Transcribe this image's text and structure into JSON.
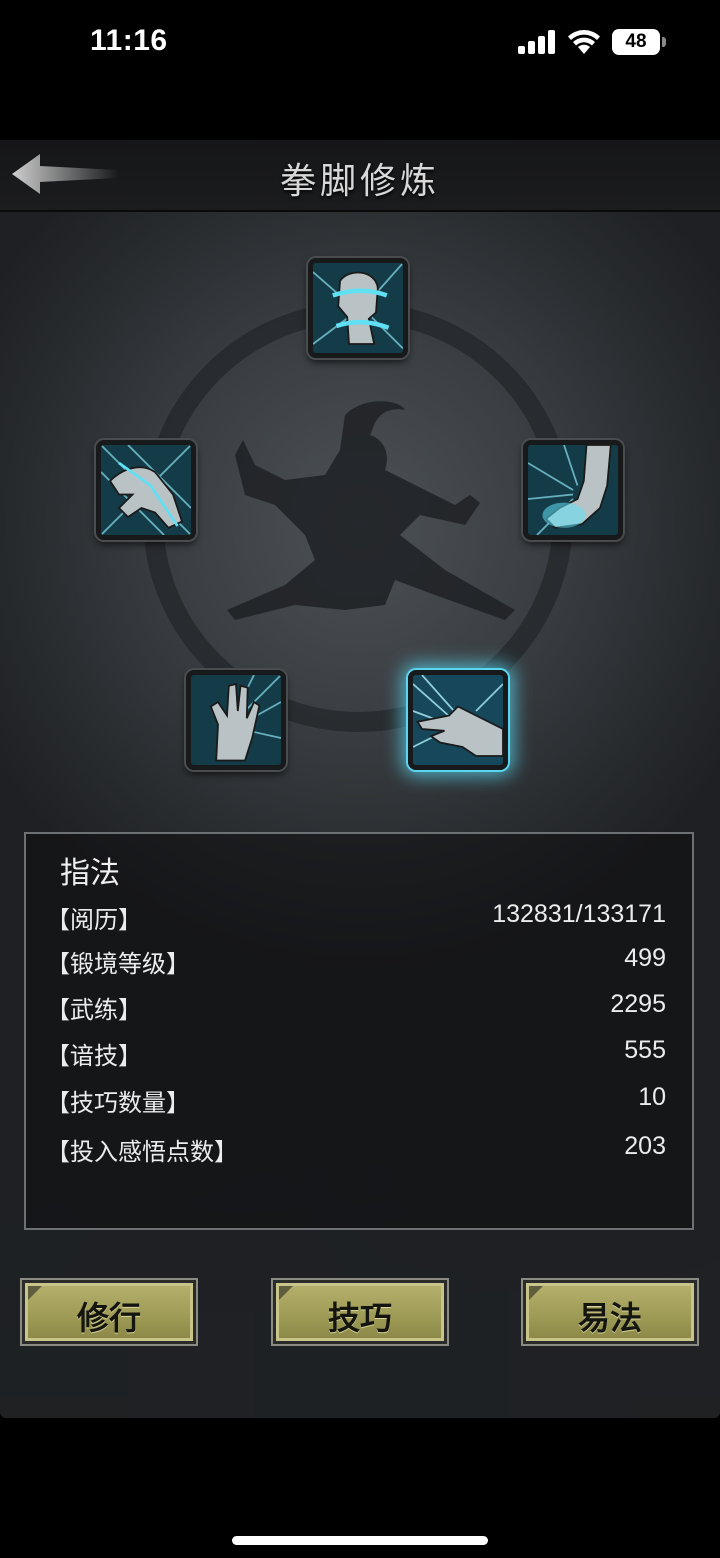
{
  "status_bar": {
    "time": "11:16",
    "battery": "48"
  },
  "header": {
    "title": "拳脚修炼",
    "back_icon": "back-arrow-icon"
  },
  "skills": [
    {
      "name": "fist",
      "icon": "fist-skill-icon"
    },
    {
      "name": "claw",
      "icon": "claw-skill-icon"
    },
    {
      "name": "kick",
      "icon": "kick-skill-icon"
    },
    {
      "name": "palm",
      "icon": "palm-skill-icon"
    },
    {
      "name": "finger",
      "icon": "finger-skill-icon",
      "selected": true
    }
  ],
  "info": {
    "title": "指法",
    "rows": [
      {
        "label": "【阅历】",
        "value": "132831/133171"
      },
      {
        "label": "【锻境等级】",
        "value": "499"
      },
      {
        "label": "【武练】",
        "value": "2295"
      },
      {
        "label": "【谙技】",
        "value": "555"
      },
      {
        "label": "【技巧数量】",
        "value": "10"
      },
      {
        "label": "【投入感悟点数】",
        "value": "203"
      }
    ]
  },
  "actions": {
    "train": "修行",
    "technique": "技巧",
    "change_method": "易法"
  },
  "colors": {
    "accent": "#5ad6f0",
    "button": "#a7a45e"
  }
}
